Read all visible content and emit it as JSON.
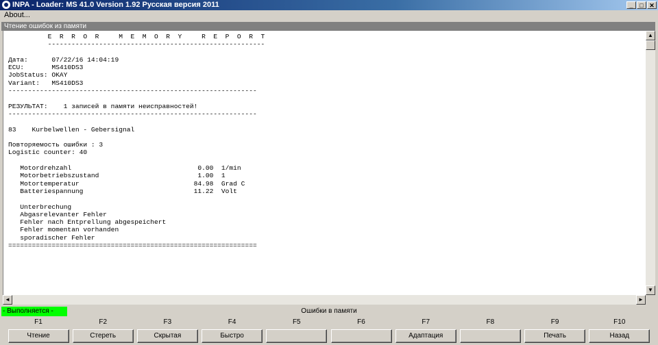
{
  "window": {
    "title": "INPA - Loader:  MS 41.0 Version 1.92  Русская версия 2011",
    "controls": [
      "_",
      "□",
      "✕"
    ]
  },
  "menu": {
    "about": "About..."
  },
  "subwindow": {
    "title": "Чтение ошибок из памяти"
  },
  "report": {
    "lines": [
      "          E  R  R  O  R     M  E  M  O  R  Y     R  E  P  O  R  T",
      "          -------------------------------------------------------",
      "",
      "Дата:      07/22/16 14:04:19",
      "ECU:       MS410DS3",
      "JobStatus: OKAY",
      "Variant:   MS410DS3",
      "---------------------------------------------------------------",
      "",
      "РЕЗУЛЬТАТ:    1 записей в памяти неисправностей!",
      "---------------------------------------------------------------",
      "",
      "83    Kurbelwellen - Gebersignal",
      "",
      "Повторяемость ошибки : 3",
      "Logistic counter: 40",
      "",
      "   Motordrehzahl                                0.00  1/min",
      "   Motorbetriebszustand                         1.00  1",
      "   Motortemperatur                             84.98  Grad C",
      "   Batteriespannung                            11.22  Volt",
      "",
      "   Unterbrechung",
      "   Abgasrelevanter Fehler",
      "   Fehler nach Entprellung abgespeichert",
      "   Fehler momentan vorhanden",
      "   sporadischer Fehler",
      "==============================================================="
    ]
  },
  "scrollbar": {
    "up": "▲",
    "down": "▼",
    "left": "◄",
    "right": "►"
  },
  "status": {
    "running": "- Выполняется -",
    "center": "Ошибки в памяти",
    "running_color": "#00ff00"
  },
  "function_keys": [
    {
      "key": "F1",
      "label": "Чтение"
    },
    {
      "key": "F2",
      "label": "Стереть"
    },
    {
      "key": "F3",
      "label": "Скрытая"
    },
    {
      "key": "F4",
      "label": "Быстро"
    },
    {
      "key": "F5",
      "label": ""
    },
    {
      "key": "F6",
      "label": ""
    },
    {
      "key": "F7",
      "label": "Адаптация"
    },
    {
      "key": "F8",
      "label": ""
    },
    {
      "key": "F9",
      "label": "Печать"
    },
    {
      "key": "F10",
      "label": "Назад"
    }
  ]
}
